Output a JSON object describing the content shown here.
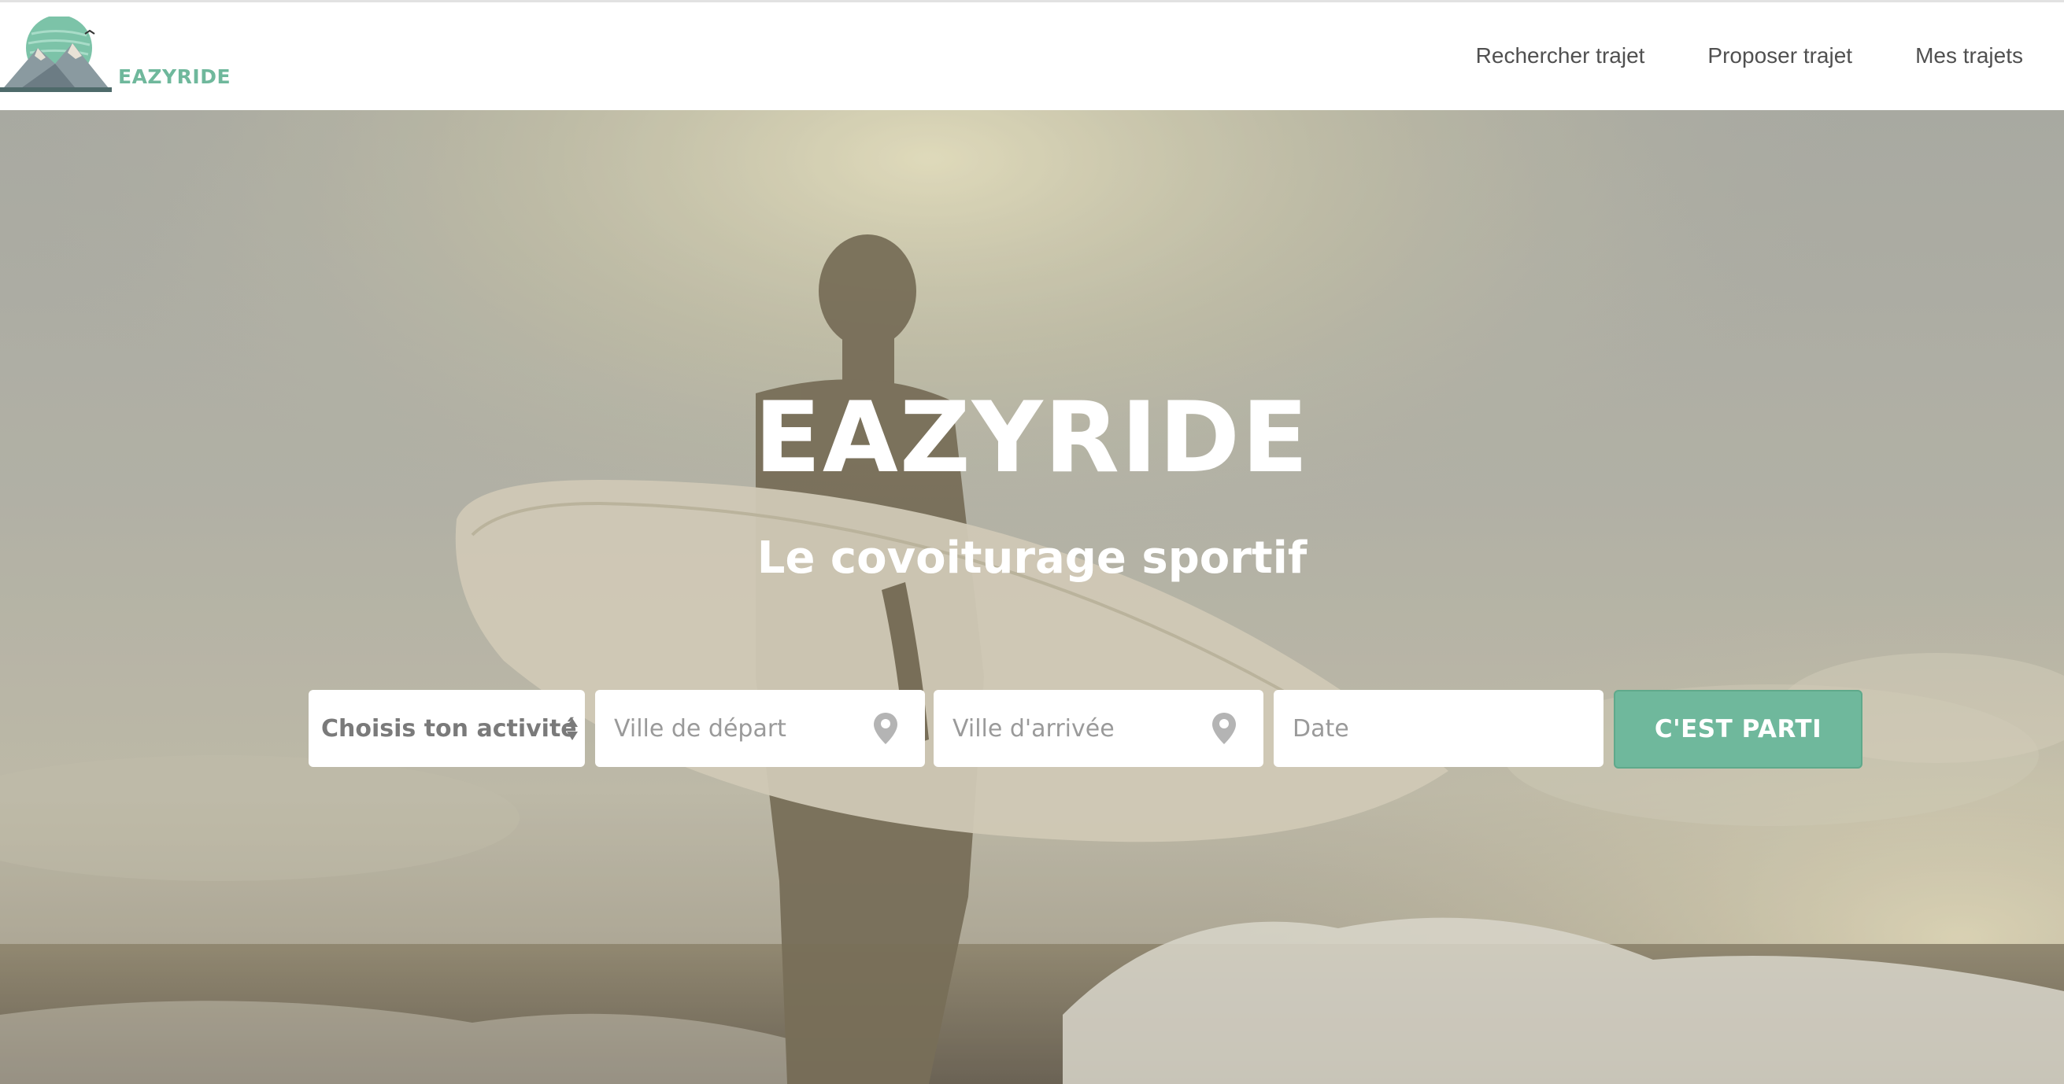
{
  "navbar": {
    "logo_text": "EAZYRIDE",
    "links": [
      "Rechercher trajet",
      "Proposer trajet",
      "Mes trajets"
    ]
  },
  "hero": {
    "title": "EAZYRIDE",
    "subtitle": "Le covoiturage sportif"
  },
  "search": {
    "activity_select": "Choisis ton activité",
    "departure_placeholder": "Ville de départ",
    "arrival_placeholder": "Ville d'arrivée",
    "date_placeholder": "Date",
    "submit_label": "C'EST PARTI"
  },
  "colors": {
    "brand_green": "#6fb89c",
    "nav_text": "#505050",
    "placeholder": "#9a9a9a"
  },
  "icons": {
    "departure": "location-pin-icon",
    "arrival": "location-pin-icon",
    "select": "sort-arrows-icon"
  }
}
